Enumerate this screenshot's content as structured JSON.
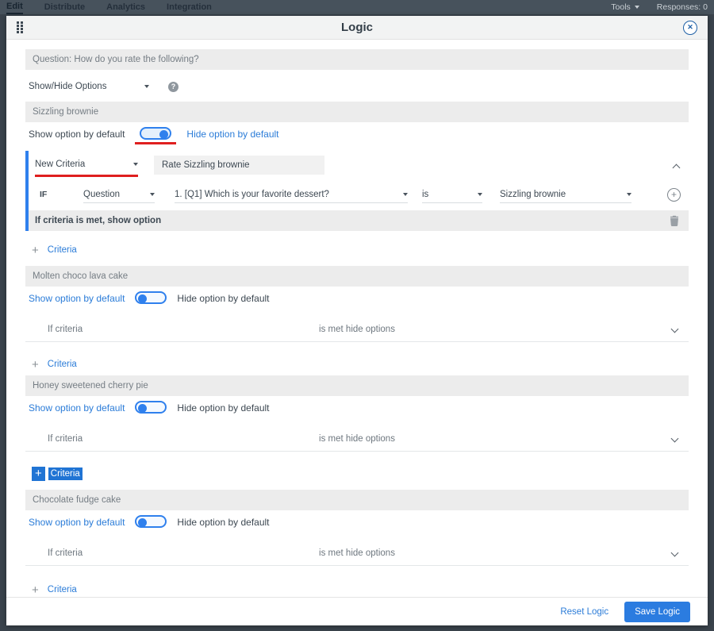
{
  "topbar": {
    "tabs": [
      {
        "label": "Edit",
        "active": true
      },
      {
        "label": "Distribute",
        "active": false
      },
      {
        "label": "Analytics",
        "active": false
      },
      {
        "label": "Integration",
        "active": false
      }
    ],
    "tools_label": "Tools",
    "responses_label": "Responses: 0"
  },
  "modal": {
    "title": "Logic",
    "question_bar": "Question: How do you rate the following?",
    "logic_type_value": "Show/Hide Options",
    "footer": {
      "reset_label": "Reset Logic",
      "save_label": "Save Logic"
    }
  },
  "labels": {
    "show_default": "Show option by default",
    "hide_default": "Hide option by default",
    "if": "IF",
    "criteria": "Criteria",
    "if_criteria": "If criteria",
    "met_hide": "is met hide options"
  },
  "expanded_section": {
    "name": "Sizzling brownie",
    "criteria_name": "New Criteria",
    "criteria_title": "Rate Sizzling brownie",
    "subject": "Question",
    "question": "1. [Q1] Which is your favorite dessert?",
    "operator": "is",
    "value": "Sizzling brownie",
    "met_text": "If criteria is met, show option"
  },
  "sections": [
    {
      "name": "Molten choco lava cake"
    },
    {
      "name": "Honey sweetened cherry pie"
    },
    {
      "name": "Chocolate fudge cake"
    }
  ],
  "icons": {
    "help": "?",
    "close": "✕",
    "plus": "+"
  },
  "colors": {
    "accent_blue": "#2f80ed",
    "link_blue": "#2b7cd8",
    "annotation_red": "#df1f1f",
    "selection_blue": "#2074d4",
    "topbar_bg": "#47525c",
    "bar_gray": "#ececec"
  }
}
